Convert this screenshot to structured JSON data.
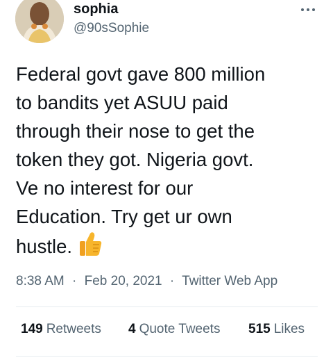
{
  "author": {
    "display_name": "sophia",
    "handle": "@90sSophie"
  },
  "tweet": {
    "lines": [
      "Federal govt gave 800 million",
      "to bandits yet ASUU paid",
      "through their nose to get the",
      "token they got. Nigeria govt.",
      "Ve no interest for our",
      "Education. Try get ur own",
      "hustle."
    ],
    "emoji_icon": "thumbs-up-emoji"
  },
  "meta": {
    "time": "8:38 AM",
    "date": "Feb 20, 2021",
    "separator": "·",
    "source": "Twitter Web App"
  },
  "stats": {
    "retweets": {
      "count": "149",
      "label": "Retweets"
    },
    "quote_tweets": {
      "count": "4",
      "label": "Quote Tweets"
    },
    "likes": {
      "count": "515",
      "label": "Likes"
    }
  },
  "icons": {
    "more": "more-horizontal-icon",
    "avatar": "profile-avatar"
  },
  "colors": {
    "text_primary": "#0f1419",
    "text_secondary": "#536471",
    "divider": "#e6ecf0"
  }
}
